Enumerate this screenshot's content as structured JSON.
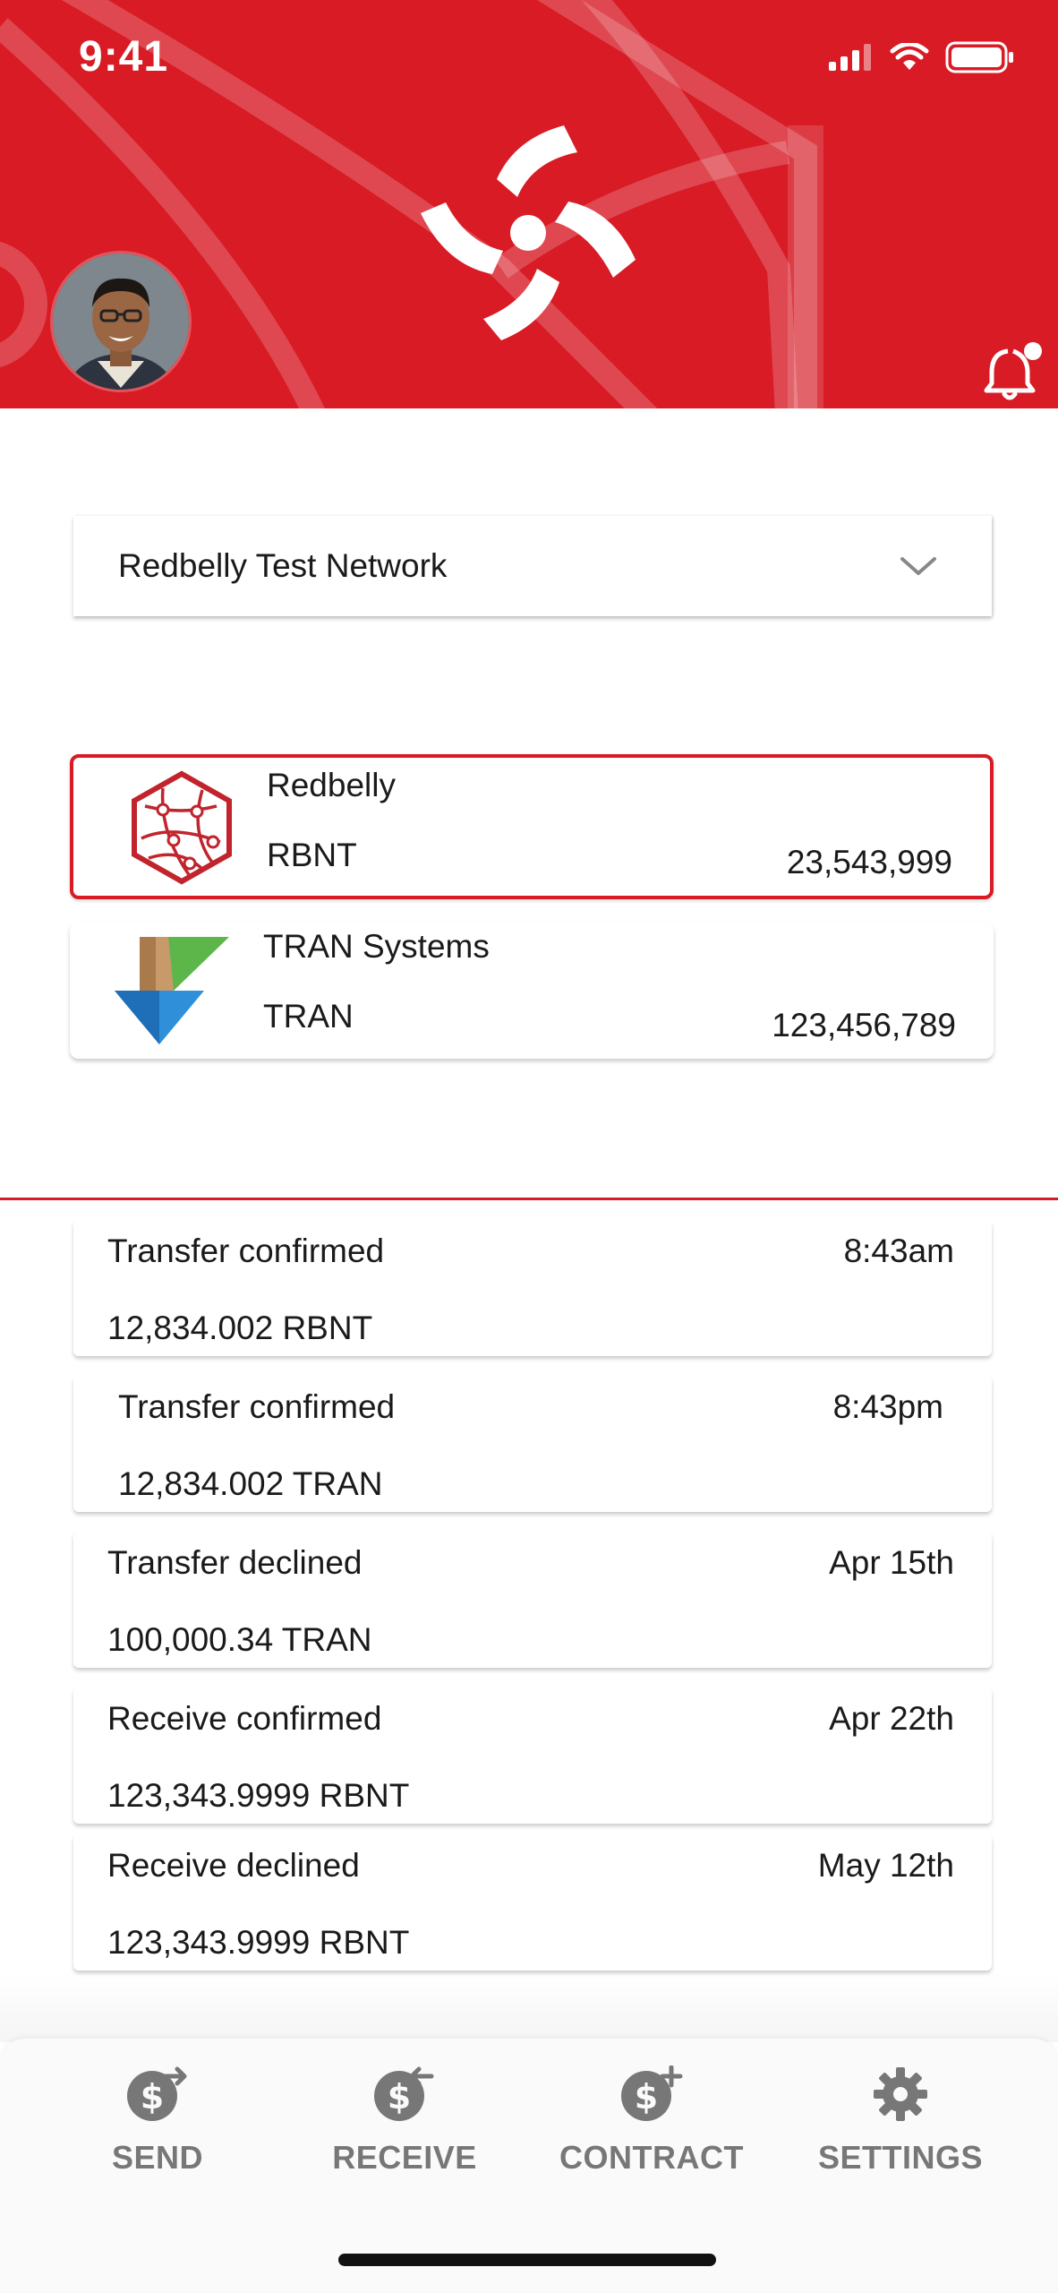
{
  "status_bar": {
    "time": "9:41"
  },
  "network": {
    "selected": "Redbelly Test Network"
  },
  "tokens": [
    {
      "name": "Redbelly",
      "symbol": "RBNT",
      "balance": "23,543,999",
      "selected": true
    },
    {
      "name": "TRAN Systems",
      "symbol": "TRAN",
      "balance": "123,456,789",
      "selected": false
    }
  ],
  "transactions": [
    {
      "title": "Transfer confirmed",
      "time": "8:43am",
      "amount": "12,834.002 RBNT"
    },
    {
      "title": "Transfer confirmed",
      "time": "8:43pm",
      "amount": "12,834.002 TRAN"
    },
    {
      "title": "Transfer declined",
      "time": "Apr 15th",
      "amount": "100,000.34 TRAN"
    },
    {
      "title": "Receive confirmed",
      "time": "Apr 22th",
      "amount": "123,343.9999 RBNT"
    },
    {
      "title": "Receive declined",
      "time": "May 12th",
      "amount": "123,343.9999 RBNT"
    }
  ],
  "nav": {
    "send": "SEND",
    "receive": "RECEIVE",
    "contract": "CONTRACT",
    "settings": "SETTINGS"
  },
  "colors": {
    "brand_red": "#d81b25",
    "nav_gray": "#777777"
  }
}
